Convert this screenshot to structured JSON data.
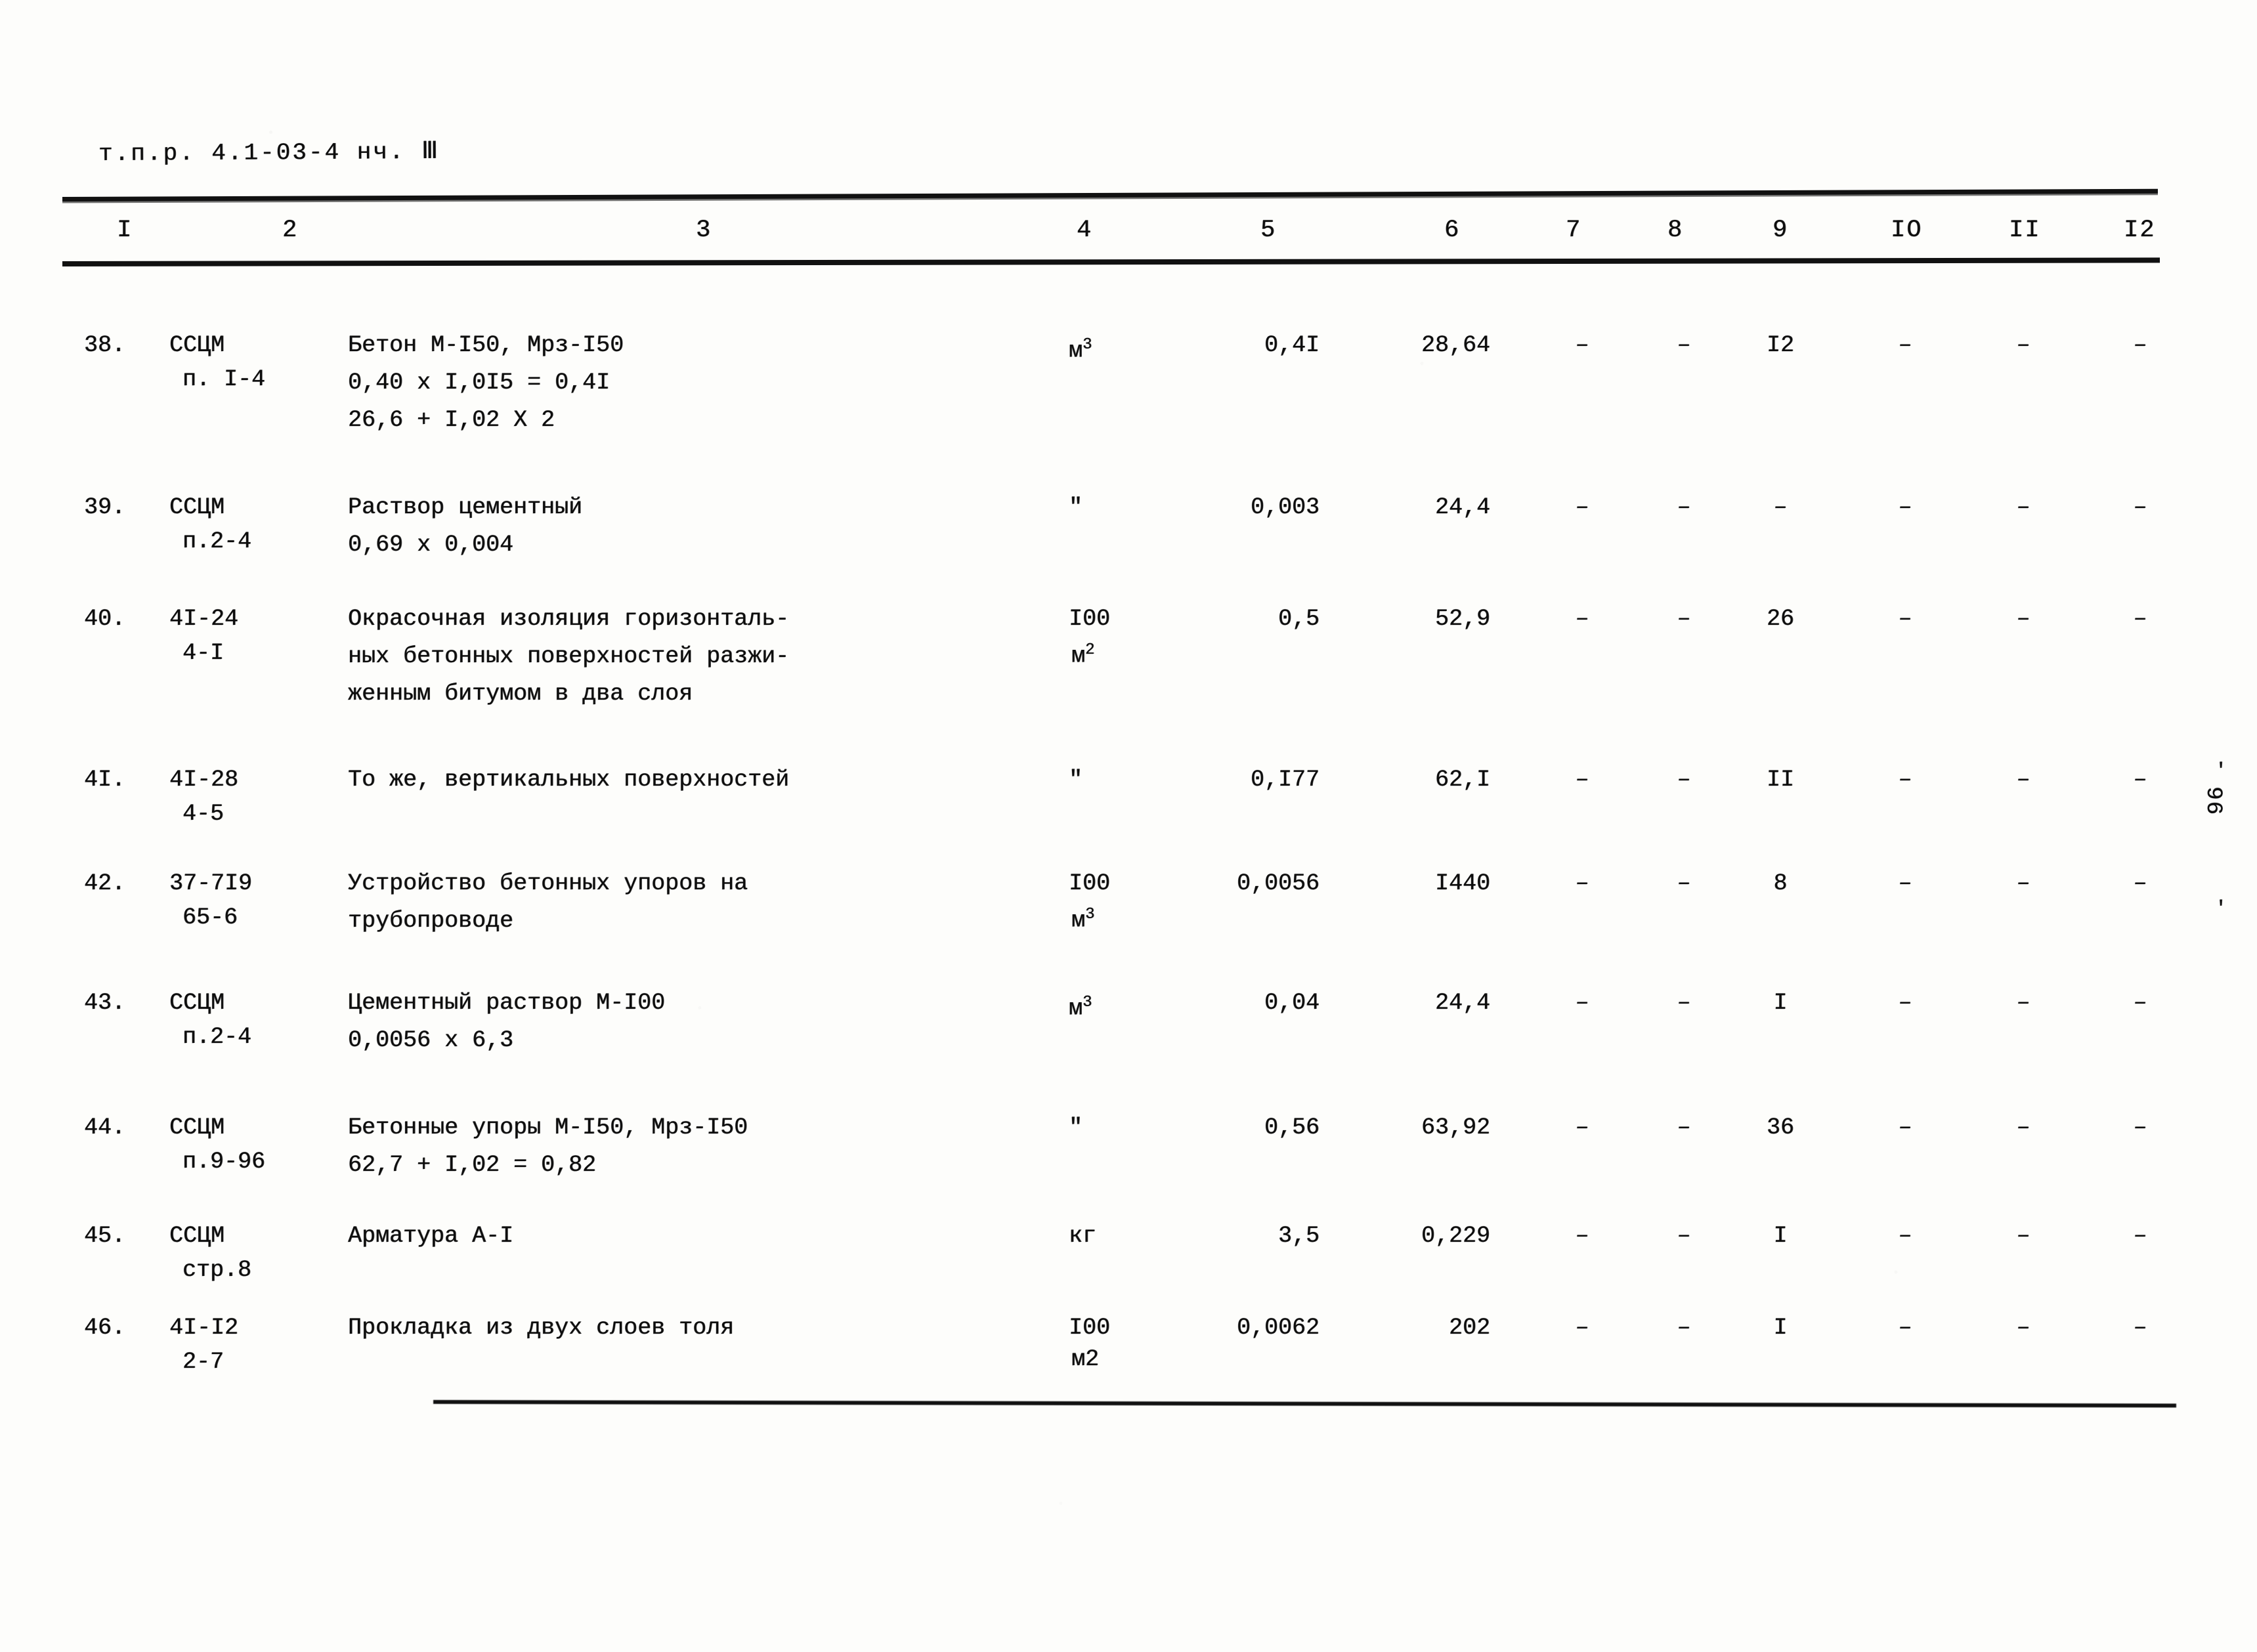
{
  "document": {
    "header_code": "т.п.р. 4.1-03-4  нч. Ⅲ",
    "side_page_number": "96",
    "side_tick_top": "'",
    "side_tick_bottom": "'"
  },
  "table": {
    "column_headers": [
      "I",
      "2",
      "3",
      "4",
      "5",
      "6",
      "7",
      "8",
      "9",
      "IO",
      "II",
      "I2"
    ],
    "dash": "–",
    "rows": [
      {
        "num": "38.",
        "code_line1": "ССЦМ",
        "code_line2": "п. I-4",
        "desc_line1": "Бетон М-I50, Мрз-I50",
        "desc_line2": "0,40 х I,0I5 = 0,4I",
        "desc_line3": "26,6 + I,02 Х 2",
        "unit_main": "м",
        "unit_sup": "3",
        "unit_sub": "",
        "qty": "0,4I",
        "price": "28,64",
        "col7": "–",
        "col8": "–",
        "col9": "I2",
        "col10": "–",
        "col11": "–",
        "col12": "–"
      },
      {
        "num": "39.",
        "code_line1": "ССЦМ",
        "code_line2": "п.2-4",
        "desc_line1": "Раствор цементный",
        "desc_line2": "0,69 х 0,004",
        "desc_line3": "",
        "unit_main": "\"",
        "unit_sup": "",
        "unit_sub": "",
        "qty": "0,003",
        "price": "24,4",
        "col7": "–",
        "col8": "–",
        "col9": "–",
        "col10": "–",
        "col11": "–",
        "col12": "–"
      },
      {
        "num": "40.",
        "code_line1": "4I-24",
        "code_line2": "4-I",
        "desc_line1": "Окрасочная изоляция горизонталь-",
        "desc_line2": "ных бетонных поверхностей разжи-",
        "desc_line3": "женным битумом в два слоя",
        "unit_main": "I00",
        "unit_sup": "2",
        "unit_sub": "м",
        "qty": "0,5",
        "price": "52,9",
        "col7": "–",
        "col8": "–",
        "col9": "26",
        "col10": "–",
        "col11": "–",
        "col12": "–"
      },
      {
        "num": "4I.",
        "code_line1": "4I-28",
        "code_line2": "4-5",
        "desc_line1": "То же, вертикальных поверхностей",
        "desc_line2": "",
        "desc_line3": "",
        "unit_main": "\"",
        "unit_sup": "",
        "unit_sub": "",
        "qty": "0,I77",
        "price": "62,I",
        "col7": "–",
        "col8": "–",
        "col9": "II",
        "col10": "–",
        "col11": "–",
        "col12": "–"
      },
      {
        "num": "42.",
        "code_line1": "37-7I9",
        "code_line2": "65-6",
        "desc_line1": "Устройство бетонных упоров на",
        "desc_line2": "трубопроводе",
        "desc_line3": "",
        "unit_main": "I00",
        "unit_sup": "3",
        "unit_sub": "м",
        "qty": "0,0056",
        "price": "I440",
        "col7": "–",
        "col8": "–",
        "col9": "8",
        "col10": "–",
        "col11": "–",
        "col12": "–"
      },
      {
        "num": "43.",
        "code_line1": "ССЦМ",
        "code_line2": "п.2-4",
        "desc_line1": "Цементный раствор М-I00",
        "desc_line2": "0,0056 х 6,3",
        "desc_line3": "",
        "unit_main": "м",
        "unit_sup": "3",
        "unit_sub": "",
        "qty": "0,04",
        "price": "24,4",
        "col7": "–",
        "col8": "–",
        "col9": "I",
        "col10": "–",
        "col11": "–",
        "col12": "–"
      },
      {
        "num": "44.",
        "code_line1": "ССЦМ",
        "code_line2": "п.9-96",
        "desc_line1": "Бетонные упоры М-I50, Мрз-I50",
        "desc_line2": "62,7 + I,02 = 0,82",
        "desc_line3": "",
        "unit_main": "\"",
        "unit_sup": "",
        "unit_sub": "",
        "qty": "0,56",
        "price": "63,92",
        "col7": "–",
        "col8": "–",
        "col9": "36",
        "col10": "–",
        "col11": "–",
        "col12": "–"
      },
      {
        "num": "45.",
        "code_line1": "ССЦМ",
        "code_line2": "стр.8",
        "desc_line1": "Арматура А-I",
        "desc_line2": "",
        "desc_line3": "",
        "unit_main": "кг",
        "unit_sup": "",
        "unit_sub": "",
        "qty": "3,5",
        "price": "0,229",
        "col7": "–",
        "col8": "–",
        "col9": "I",
        "col10": "–",
        "col11": "–",
        "col12": "–"
      },
      {
        "num": "46.",
        "code_line1": "4I-I2",
        "code_line2": "2-7",
        "desc_line1": "Прокладка из двух слоев толя",
        "desc_line2": "",
        "desc_line3": "",
        "unit_main": "I00",
        "unit_sup": "",
        "unit_sub": "м2",
        "qty": "0,0062",
        "price": "202",
        "col7": "–",
        "col8": "–",
        "col9": "I",
        "col10": "–",
        "col11": "–",
        "col12": "–"
      }
    ]
  }
}
